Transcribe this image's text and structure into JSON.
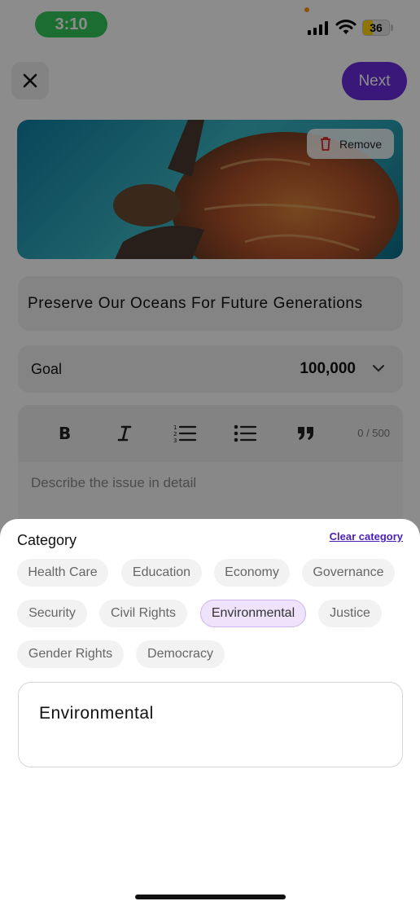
{
  "status_bar": {
    "time": "3:10",
    "battery": "36"
  },
  "header": {
    "close_icon": "close-icon",
    "next_label": "Next"
  },
  "cover": {
    "remove_label": "Remove"
  },
  "petition": {
    "title": "Preserve Our Oceans For Future Generations",
    "goal_label": "Goal",
    "goal_value": "100,000"
  },
  "editor": {
    "tools": [
      "bold-icon",
      "italic-icon",
      "ordered-list-icon",
      "bullet-list-icon",
      "quote-icon"
    ],
    "char_count": "0 / 500",
    "placeholder": "Describe the issue in detail"
  },
  "category_sheet": {
    "title": "Category",
    "clear_label": "Clear category",
    "chips": [
      "Health Care",
      "Education",
      "Economy",
      "Governance",
      "Security",
      "Civil Rights",
      "Environmental",
      "Justice",
      "Gender Rights",
      "Democracy"
    ],
    "selected": "Environmental",
    "input_value": "Environmental"
  },
  "colors": {
    "accent": "#6a2dde",
    "chip_selected_bg": "#eee3fb",
    "link": "#4b1fb5"
  }
}
